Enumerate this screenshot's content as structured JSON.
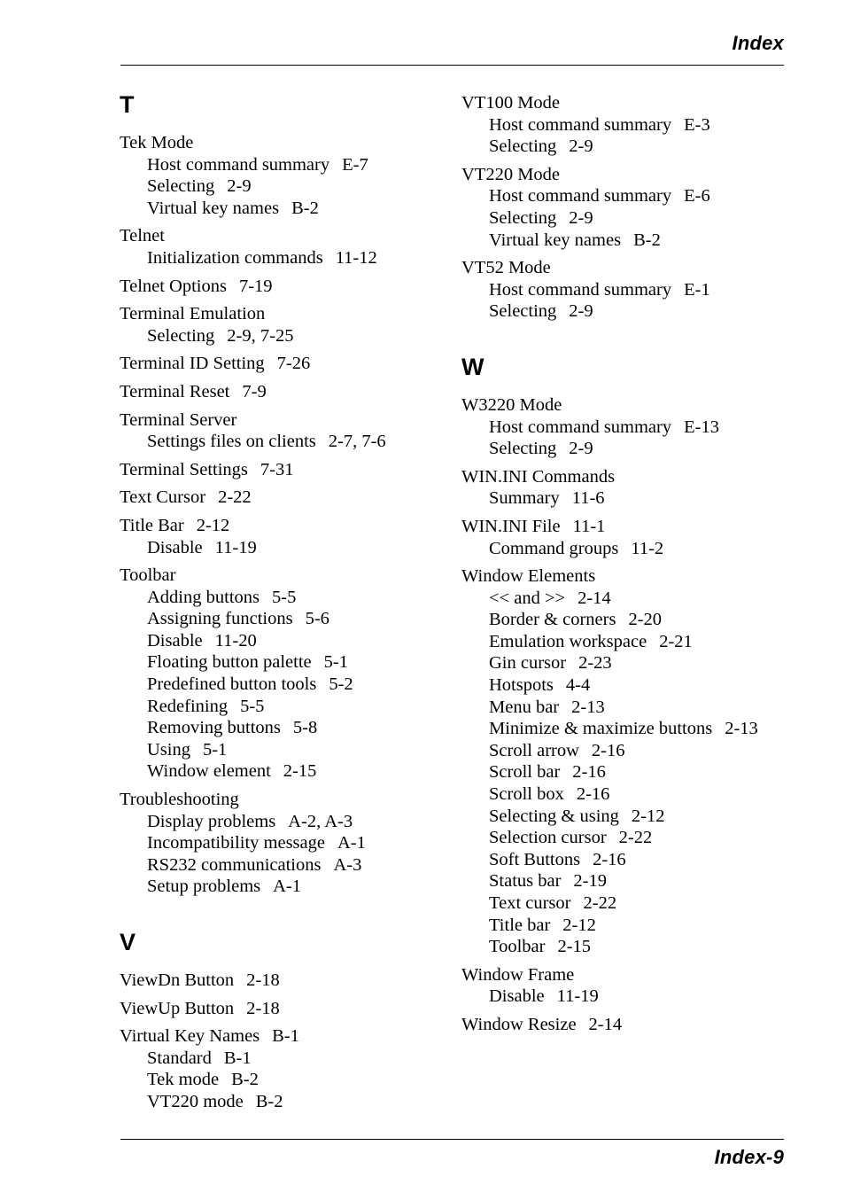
{
  "header": {
    "title": "Index"
  },
  "footer": {
    "folio": "Index-9"
  },
  "columns": {
    "left": {
      "sections": [
        {
          "letter": "T",
          "groups": [
            {
              "main": {
                "text": "Tek Mode",
                "page": ""
              },
              "subs": [
                {
                  "text": "Host command summary",
                  "page": "E-7"
                },
                {
                  "text": "Selecting",
                  "page": "2-9"
                },
                {
                  "text": "Virtual key names",
                  "page": "B-2"
                }
              ]
            },
            {
              "main": {
                "text": "Telnet",
                "page": ""
              },
              "subs": [
                {
                  "text": "Initialization commands",
                  "page": "11-12"
                }
              ]
            },
            {
              "main": {
                "text": "Telnet Options",
                "page": "7-19"
              },
              "subs": []
            },
            {
              "main": {
                "text": "Terminal Emulation",
                "page": ""
              },
              "subs": [
                {
                  "text": "Selecting",
                  "page": "2-9,  7-25"
                }
              ]
            },
            {
              "main": {
                "text": "Terminal ID Setting",
                "page": "7-26"
              },
              "subs": []
            },
            {
              "main": {
                "text": "Terminal Reset",
                "page": "7-9"
              },
              "subs": []
            },
            {
              "main": {
                "text": "Terminal Server",
                "page": ""
              },
              "subs": [
                {
                  "text": "Settings files on clients",
                  "page": "2-7,  7-6"
                }
              ]
            },
            {
              "main": {
                "text": "Terminal Settings",
                "page": "7-31"
              },
              "subs": []
            },
            {
              "main": {
                "text": "Text Cursor",
                "page": "2-22"
              },
              "subs": []
            },
            {
              "main": {
                "text": "Title Bar",
                "page": "2-12"
              },
              "subs": [
                {
                  "text": "Disable",
                  "page": "11-19"
                }
              ]
            },
            {
              "main": {
                "text": "Toolbar",
                "page": ""
              },
              "subs": [
                {
                  "text": "Adding buttons",
                  "page": "5-5"
                },
                {
                  "text": "Assigning functions",
                  "page": "5-6"
                },
                {
                  "text": "Disable",
                  "page": "11-20"
                },
                {
                  "text": "Floating button palette",
                  "page": "5-1"
                },
                {
                  "text": "Predefined button tools",
                  "page": "5-2"
                },
                {
                  "text": "Redefining",
                  "page": "5-5"
                },
                {
                  "text": "Removing buttons",
                  "page": "5-8"
                },
                {
                  "text": "Using",
                  "page": "5-1"
                },
                {
                  "text": "Window element",
                  "page": "2-15"
                }
              ]
            },
            {
              "main": {
                "text": "Troubleshooting",
                "page": ""
              },
              "subs": [
                {
                  "text": "Display problems",
                  "page": "A-2,  A-3"
                },
                {
                  "text": "Incompatibility message",
                  "page": "A-1"
                },
                {
                  "text": "RS232 communications",
                  "page": "A-3"
                },
                {
                  "text": "Setup problems",
                  "page": "A-1"
                }
              ]
            }
          ]
        },
        {
          "letter": "V",
          "groups": [
            {
              "main": {
                "text": "ViewDn Button",
                "page": "2-18"
              },
              "subs": []
            },
            {
              "main": {
                "text": "ViewUp Button",
                "page": "2-18"
              },
              "subs": []
            },
            {
              "main": {
                "text": "Virtual Key Names",
                "page": "B-1"
              },
              "subs": [
                {
                  "text": "Standard",
                  "page": "B-1"
                },
                {
                  "text": "Tek mode",
                  "page": "B-2"
                },
                {
                  "text": "VT220 mode",
                  "page": "B-2"
                }
              ]
            }
          ]
        }
      ]
    },
    "right": {
      "sections": [
        {
          "letter": "",
          "groups": [
            {
              "main": {
                "text": "VT100 Mode",
                "page": ""
              },
              "subs": [
                {
                  "text": "Host command summary",
                  "page": "E-3"
                },
                {
                  "text": "Selecting",
                  "page": "2-9"
                }
              ]
            },
            {
              "main": {
                "text": "VT220 Mode",
                "page": ""
              },
              "subs": [
                {
                  "text": "Host command summary",
                  "page": "E-6"
                },
                {
                  "text": "Selecting",
                  "page": "2-9"
                },
                {
                  "text": "Virtual key names",
                  "page": "B-2"
                }
              ]
            },
            {
              "main": {
                "text": "VT52 Mode",
                "page": ""
              },
              "subs": [
                {
                  "text": "Host command summary",
                  "page": "E-1"
                },
                {
                  "text": "Selecting",
                  "page": "2-9"
                }
              ]
            }
          ]
        },
        {
          "letter": "W",
          "groups": [
            {
              "main": {
                "text": "W3220 Mode",
                "page": ""
              },
              "subs": [
                {
                  "text": "Host command summary",
                  "page": "E-13"
                },
                {
                  "text": "Selecting",
                  "page": "2-9"
                }
              ]
            },
            {
              "main": {
                "text": "WIN.INI Commands",
                "page": ""
              },
              "subs": [
                {
                  "text": "Summary",
                  "page": "11-6"
                }
              ]
            },
            {
              "main": {
                "text": "WIN.INI File",
                "page": "11-1"
              },
              "subs": [
                {
                  "text": "Command groups",
                  "page": "11-2"
                }
              ]
            },
            {
              "main": {
                "text": "Window Elements",
                "page": ""
              },
              "subs": [
                {
                  "text": "<< and >>",
                  "page": "2-14"
                },
                {
                  "text": "Border & corners",
                  "page": "2-20"
                },
                {
                  "text": "Emulation workspace",
                  "page": "2-21"
                },
                {
                  "text": "Gin cursor",
                  "page": "2-23"
                },
                {
                  "text": "Hotspots",
                  "page": "4-4"
                },
                {
                  "text": "Menu bar",
                  "page": "2-13"
                },
                {
                  "text": "Minimize & maximize buttons",
                  "page": "2-13"
                },
                {
                  "text": "Scroll arrow",
                  "page": "2-16"
                },
                {
                  "text": "Scroll bar",
                  "page": "2-16"
                },
                {
                  "text": "Scroll box",
                  "page": "2-16"
                },
                {
                  "text": "Selecting & using",
                  "page": "2-12"
                },
                {
                  "text": "Selection cursor",
                  "page": "2-22"
                },
                {
                  "text": "Soft Buttons",
                  "page": "2-16"
                },
                {
                  "text": "Status bar",
                  "page": "2-19"
                },
                {
                  "text": "Text cursor",
                  "page": "2-22"
                },
                {
                  "text": "Title bar",
                  "page": "2-12"
                },
                {
                  "text": "Toolbar",
                  "page": "2-15"
                }
              ]
            },
            {
              "main": {
                "text": "Window Frame",
                "page": ""
              },
              "subs": [
                {
                  "text": "Disable",
                  "page": "11-19"
                }
              ]
            },
            {
              "main": {
                "text": "Window Resize",
                "page": "2-14"
              },
              "subs": []
            }
          ]
        }
      ]
    }
  }
}
